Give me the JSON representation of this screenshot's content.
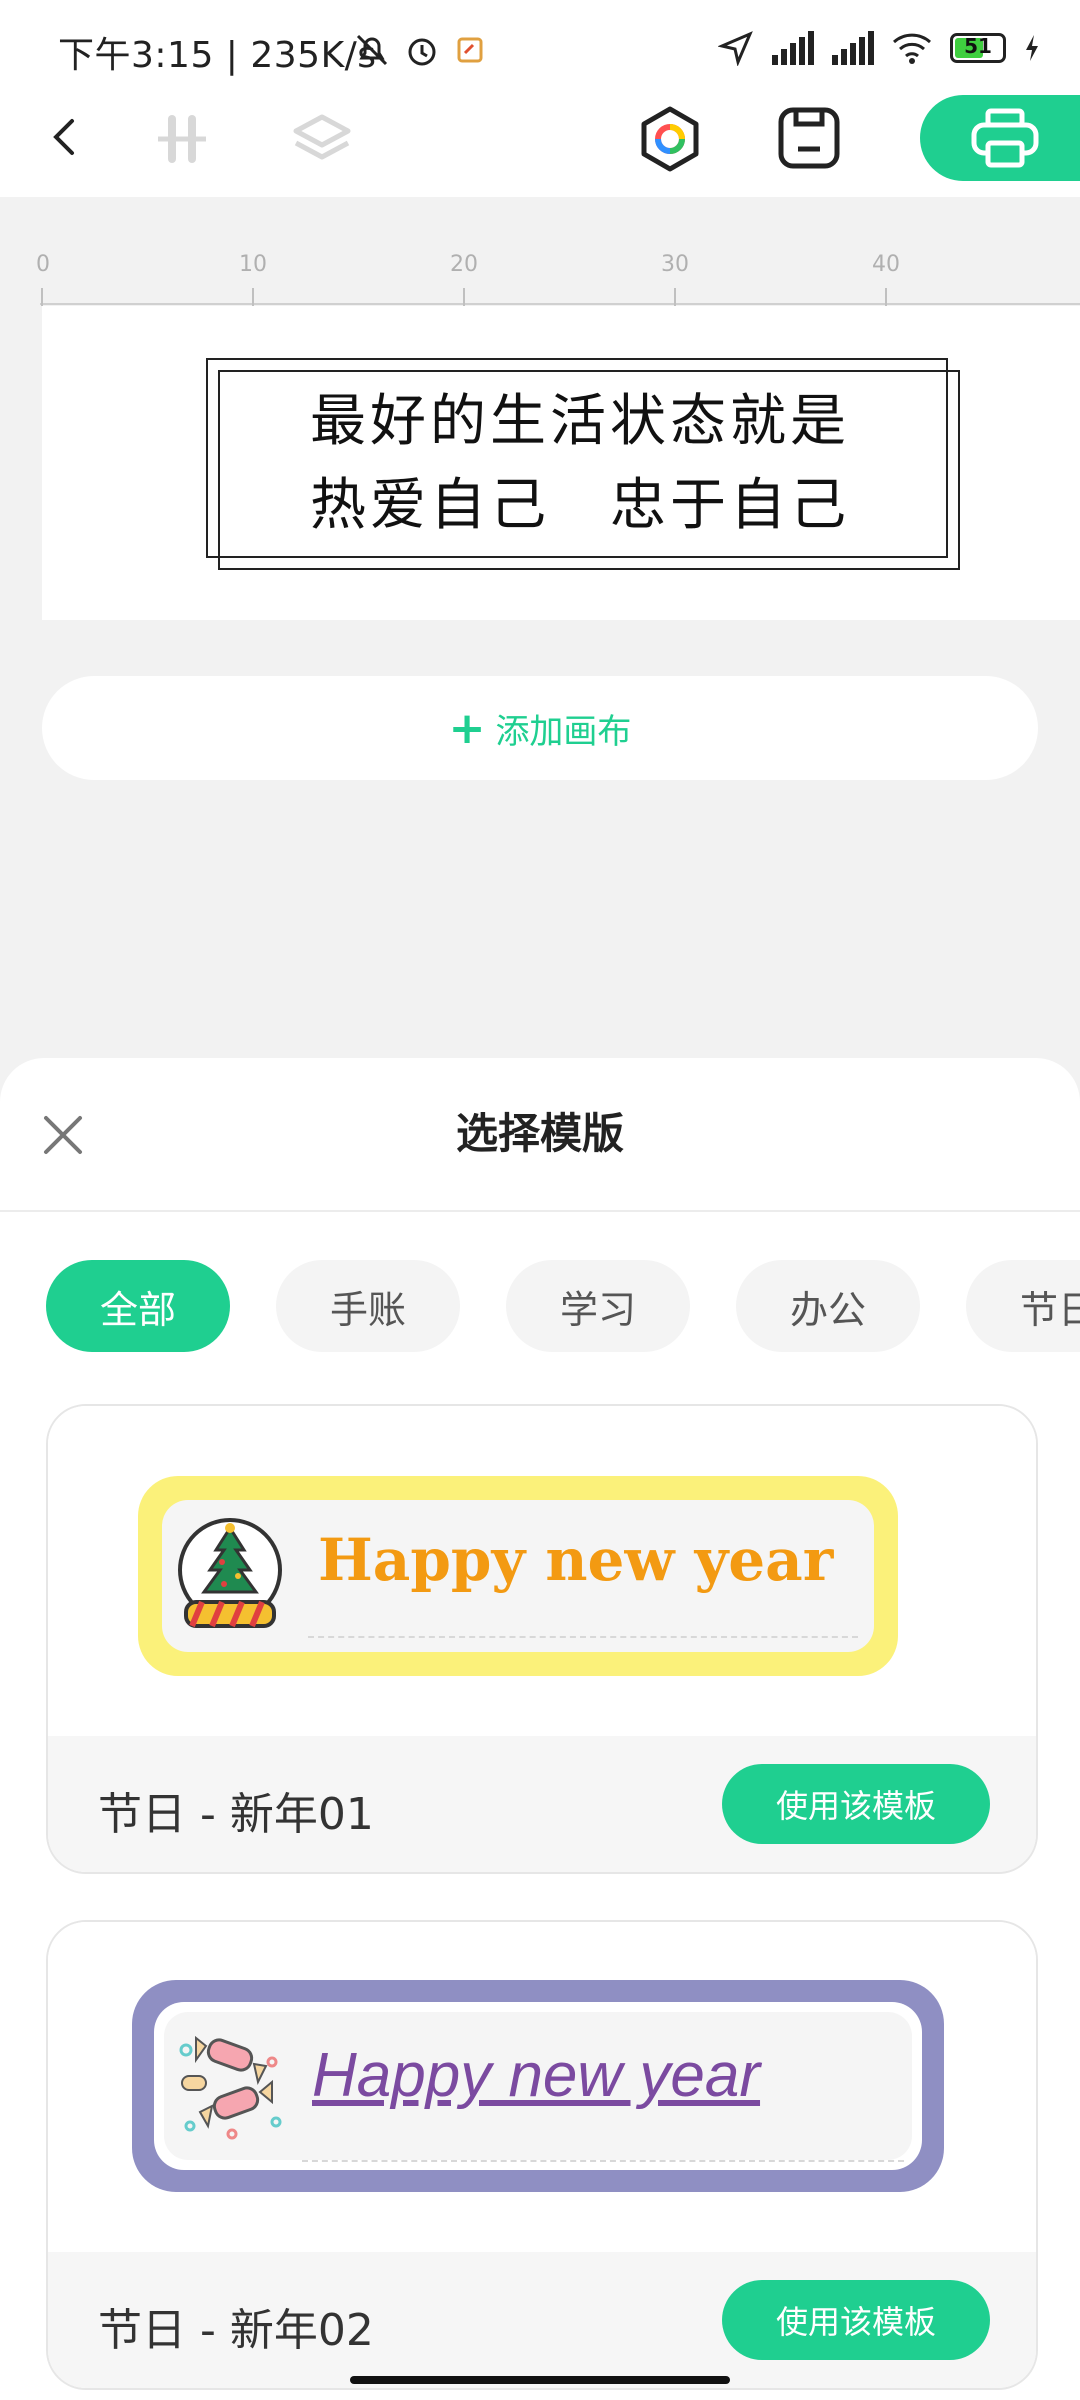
{
  "status_bar": {
    "time": "下午3:15 | 235K/s",
    "battery": "51"
  },
  "toolbar": {
    "back": "back-icon",
    "align": "align-icon",
    "layers": "layers-icon",
    "color": "color-ring-icon",
    "save": "save-icon",
    "print": "print-icon"
  },
  "ruler": {
    "ticks": [
      "0",
      "10",
      "20",
      "30",
      "40"
    ]
  },
  "canvas": {
    "line1": "最好的生活状态就是",
    "line2": "热爱自己　忠于自己"
  },
  "add_canvas_label": "添加画布",
  "sheet": {
    "title": "选择模版",
    "chips": [
      "全部",
      "手账",
      "学习",
      "办公",
      "节日"
    ],
    "active_chip": "全部",
    "templates": [
      {
        "name": "节日 - 新年01",
        "preview_text": "Happy new year",
        "button": "使用该模板"
      },
      {
        "name": "节日 - 新年02",
        "preview_text": "Happy new year",
        "button": "使用该模板"
      }
    ]
  },
  "colors": {
    "accent": "#1fcf90",
    "card_frame_yellow": "#fbf17a",
    "card_frame_purple": "#8f8fc3",
    "text_orange": "#f39a12",
    "text_purple": "#7b4aa0"
  }
}
